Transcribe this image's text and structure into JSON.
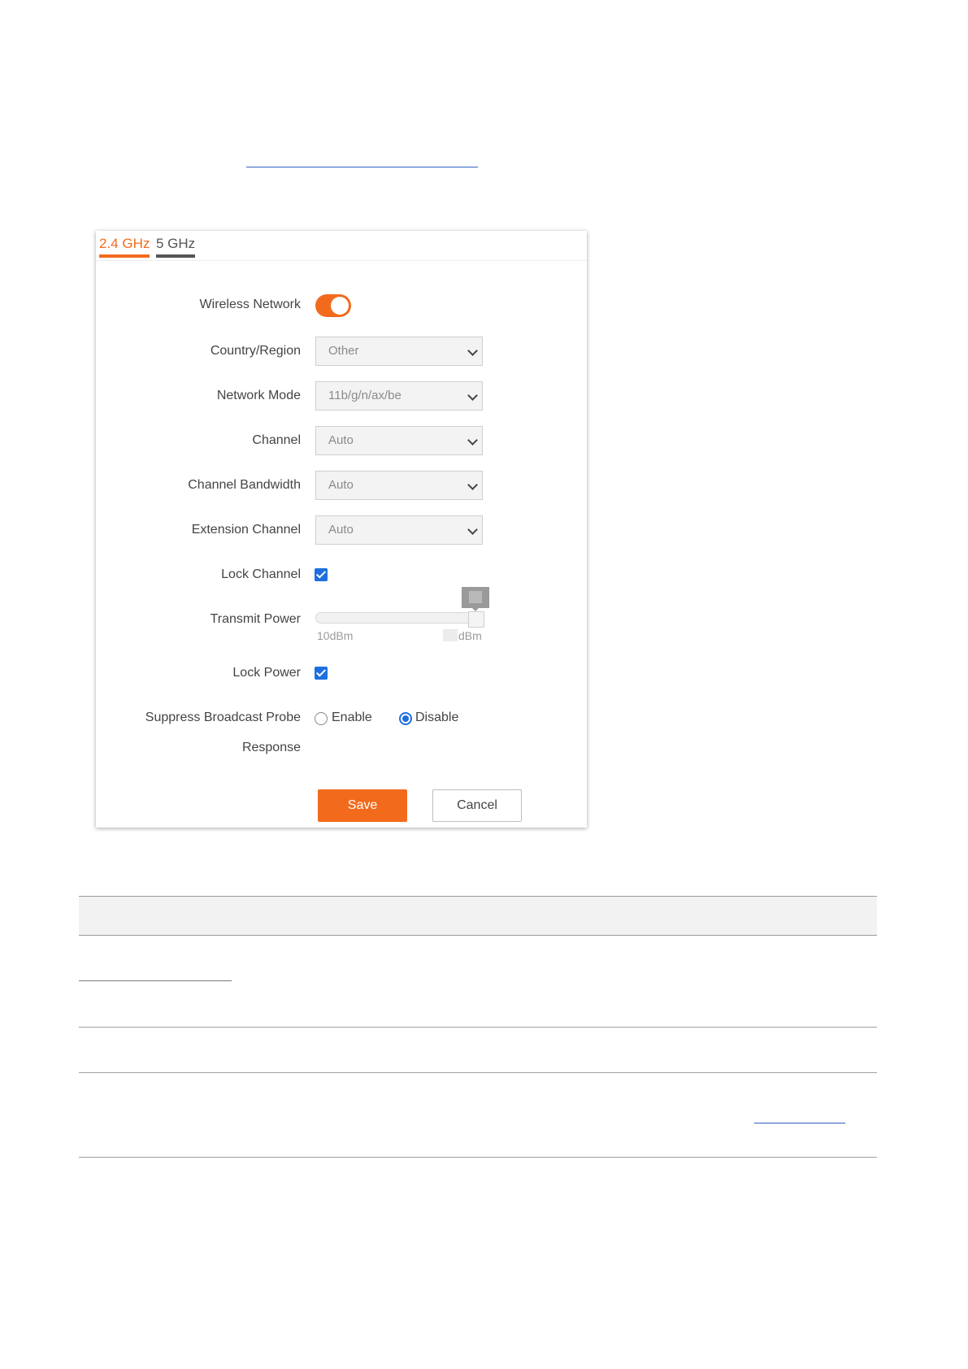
{
  "tabs": [
    {
      "label": "2.4 GHz",
      "active": true
    },
    {
      "label": "5 GHz",
      "active": false
    }
  ],
  "form": {
    "wireless_network": {
      "label": "Wireless Network",
      "enabled": true
    },
    "country_region": {
      "label": "Country/Region",
      "value": "Other"
    },
    "network_mode": {
      "label": "Network Mode",
      "value": "11b/g/n/ax/be"
    },
    "channel": {
      "label": "Channel",
      "value": "Auto"
    },
    "channel_bandwidth": {
      "label": "Channel Bandwidth",
      "value": "Auto"
    },
    "extension_channel": {
      "label": "Extension Channel",
      "value": "Auto"
    },
    "lock_channel": {
      "label": "Lock Channel",
      "checked": true
    },
    "transmit_power": {
      "label": "Transmit Power",
      "min_label": "10dBm",
      "max_label": "dBm",
      "level_percent": 100
    },
    "lock_power": {
      "label": "Lock Power",
      "checked": true
    },
    "suppress_broadcast": {
      "label_line1": "Suppress Broadcast Probe",
      "label_line2": "Response",
      "options": [
        "Enable",
        "Disable"
      ],
      "selected": "Disable"
    }
  },
  "buttons": {
    "save": "Save",
    "cancel": "Cancel"
  },
  "colors": {
    "accent": "#f26b1d",
    "checkbox": "#1d6fe0",
    "link": "#2f5fbf"
  }
}
